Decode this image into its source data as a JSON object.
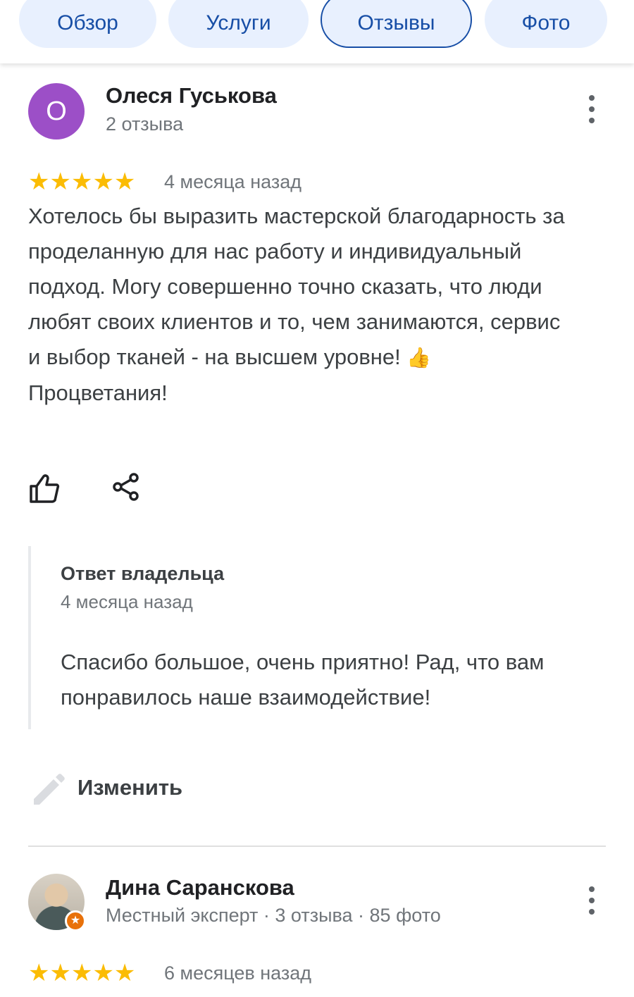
{
  "tabs": [
    {
      "label": "Обзор",
      "selected": false
    },
    {
      "label": "Услуги",
      "selected": false
    },
    {
      "label": "Отзывы",
      "selected": true
    },
    {
      "label": "Фото",
      "selected": false
    }
  ],
  "review1": {
    "avatar_letter": "О",
    "author": "Олеся Гуськова",
    "meta": "2 отзыва",
    "rating": "★★★★★",
    "time": "4 месяца назад",
    "text_1": "Хотелось бы выразить мастерской благодарность за проделанную для нас работу и индивидуальный подход. Могу совершенно точно сказать, что люди любят своих клиентов и то, чем занимаются, сервис и выбор тканей - на высшем уровне! ",
    "emoji": "👍",
    "text_2": "Процветания!",
    "owner_reply": {
      "title": "Ответ владельца",
      "time": "4 месяца назад",
      "text": "Спасибо большое, очень приятно! Рад, что вам понравилось наше взаимодействие!"
    },
    "edit_label": "Изменить"
  },
  "review2": {
    "author": "Дина Саранскова",
    "meta": "Местный эксперт · 3 отзыва · 85 фото",
    "rating": "★★★★★",
    "time": "6 месяцев назад"
  },
  "icons": {
    "more": "more-vert-icon",
    "like": "thumb-up-icon",
    "share": "share-icon",
    "edit": "pencil-icon",
    "badge": "local-guide-star-icon"
  },
  "colors": {
    "accent": "#174ea6",
    "tab_bg": "#e8f0fe",
    "star": "#fbbc04",
    "avatar": "#9c4fc7",
    "badge": "#e8710a"
  }
}
